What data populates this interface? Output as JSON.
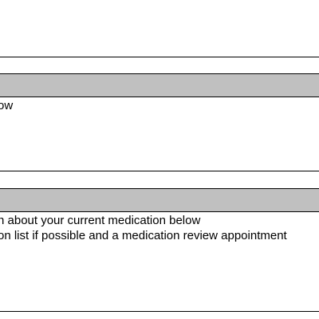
{
  "section1": {
    "instruction_fragment": "ow"
  },
  "section2": {
    "line1": "n about your current medication below",
    "line2": "on list if possible and a medication review appointment"
  },
  "colors": {
    "header_band": "#c0c0c0",
    "rule": "#000000",
    "text": "#000000"
  }
}
